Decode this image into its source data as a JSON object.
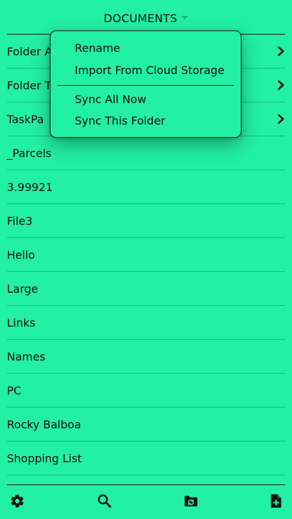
{
  "header": {
    "title": "DOCUMENTS"
  },
  "list": {
    "items": [
      {
        "label": "Folder A",
        "folder": true
      },
      {
        "label": "Folder T",
        "folder": true
      },
      {
        "label": "TaskPa",
        "folder": true
      },
      {
        "label": "_Parcels",
        "folder": false
      },
      {
        "label": "3.99921",
        "folder": false
      },
      {
        "label": "File3",
        "folder": false
      },
      {
        "label": "Hello",
        "folder": false
      },
      {
        "label": "Large",
        "folder": false
      },
      {
        "label": "Links",
        "folder": false
      },
      {
        "label": "Names",
        "folder": false
      },
      {
        "label": "PC",
        "folder": false
      },
      {
        "label": "Rocky Balboa",
        "folder": false
      },
      {
        "label": "Shopping List",
        "folder": false
      }
    ]
  },
  "menu": {
    "rename": "Rename",
    "import_cloud": "Import From Cloud Storage",
    "sync_all": "Sync All Now",
    "sync_folder": "Sync This Folder"
  },
  "toolbar": {
    "icons": [
      "gear-icon",
      "search-icon",
      "folder-sync-icon",
      "new-document-icon"
    ]
  },
  "colors": {
    "background": "#22f0a4",
    "divider": "#14b87d",
    "text": "#0a0a0a"
  }
}
